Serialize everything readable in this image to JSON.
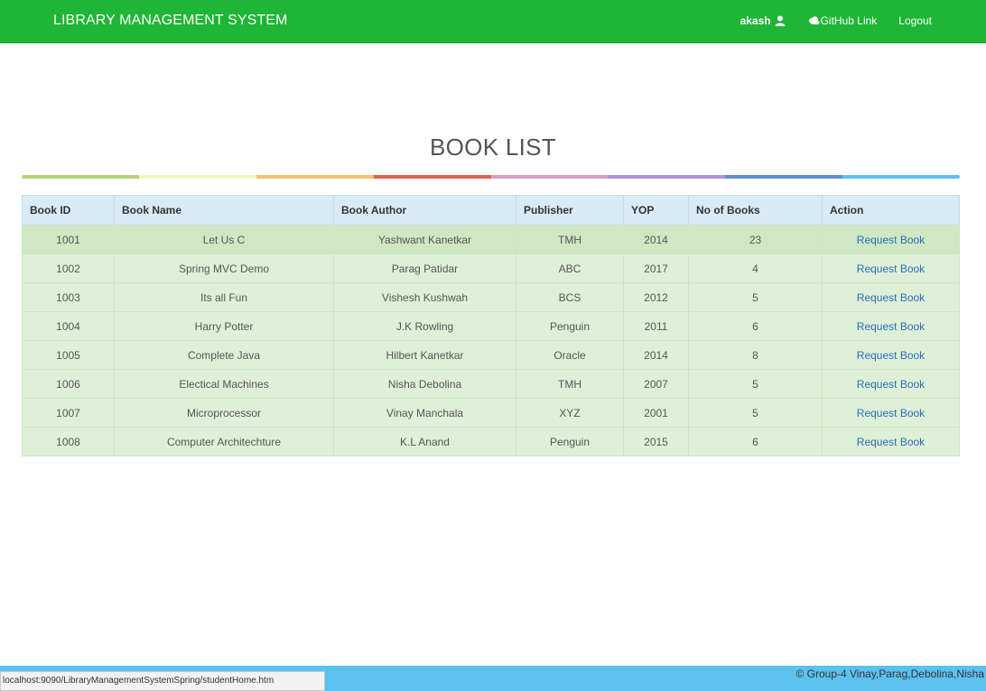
{
  "navbar": {
    "brand": "LIBRARY MANAGEMENT SYSTEM",
    "user": "akash",
    "github_label": "GitHub Link",
    "logout_label": "Logout",
    "bg_color": "#1fb536"
  },
  "page": {
    "title": "BOOK LIST"
  },
  "rainbow_colors": [
    "#b5d47a",
    "#f7f3c5",
    "#f6c36a",
    "#e0614f",
    "#d6a0c2",
    "#b48fd6",
    "#5f8fd0",
    "#5bc2ef"
  ],
  "table": {
    "headers": [
      "Book ID",
      "Book Name",
      "Book Author",
      "Publisher",
      "YOP",
      "No of Books",
      "Action"
    ],
    "rows": [
      {
        "id": "1001",
        "name": "Let Us C",
        "author": "Yashwant Kanetkar",
        "publisher": "TMH",
        "yop": "2014",
        "count": "23",
        "action": "Request Book"
      },
      {
        "id": "1002",
        "name": "Spring MVC Demo",
        "author": "Parag Patidar",
        "publisher": "ABC",
        "yop": "2017",
        "count": "4",
        "action": "Request Book"
      },
      {
        "id": "1003",
        "name": "Its all Fun",
        "author": "Vishesh Kushwah",
        "publisher": "BCS",
        "yop": "2012",
        "count": "5",
        "action": "Request Book"
      },
      {
        "id": "1004",
        "name": "Harry Potter",
        "author": "J.K Rowling",
        "publisher": "Penguin",
        "yop": "2011",
        "count": "6",
        "action": "Request Book"
      },
      {
        "id": "1005",
        "name": "Complete Java",
        "author": "Hilbert Kanetkar",
        "publisher": "Oracle",
        "yop": "2014",
        "count": "8",
        "action": "Request Book"
      },
      {
        "id": "1006",
        "name": "Electical Machines",
        "author": "Nisha Debolina",
        "publisher": "TMH",
        "yop": "2007",
        "count": "5",
        "action": "Request Book"
      },
      {
        "id": "1007",
        "name": "Microprocessor",
        "author": "Vinay Manchala",
        "publisher": "XYZ",
        "yop": "2001",
        "count": "5",
        "action": "Request Book"
      },
      {
        "id": "1008",
        "name": "Computer Architechture",
        "author": "K.L Anand",
        "publisher": "Penguin",
        "yop": "2015",
        "count": "6",
        "action": "Request Book"
      }
    ]
  },
  "footer": {
    "text": "© Group-4 Vinay,Parag,Debolina,Nisha",
    "bg_color": "#5bc2ef"
  },
  "status_bar": {
    "url": "localhost:9090/LibraryManagementSystemSpring/studentHome.htm"
  }
}
